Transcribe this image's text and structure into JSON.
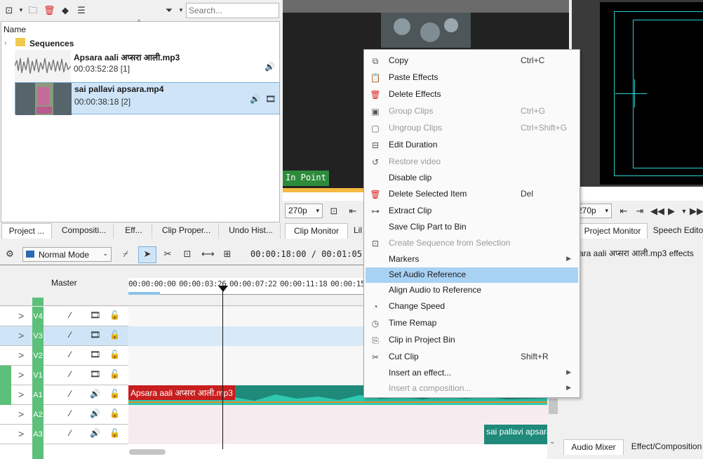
{
  "bin": {
    "search_placeholder": "Search...",
    "header_name": "Name",
    "folder": "Sequences",
    "clips": [
      {
        "name": "Apsara aali अप्सरा आली.mp3",
        "duration": "00:03:52:28 [1]"
      },
      {
        "name": "sai pallavi apsara.mp4",
        "duration": "00:00:38:18 [2]"
      }
    ]
  },
  "bottom_left_tabs": [
    "Project ...",
    "Compositi...",
    "Eff...",
    "Clip Proper...",
    "Undo Hist..."
  ],
  "clip_monitor": {
    "in_point_label": "In Point",
    "resolution": "270p",
    "tab_active": "Clip Monitor",
    "tab_next": "Lil"
  },
  "project_monitor": {
    "resolution": "270p",
    "tab_active": "Project Monitor",
    "tab_next": "Speech Edito",
    "effects_label": "sara aali अप्सरा आली.mp3 effects",
    "bottom_tabs": [
      "Audio Mixer",
      "Effect/Composition"
    ]
  },
  "timeline": {
    "mode": "Normal Mode",
    "timecode": "00:00:18:00 / 00:01:05:",
    "master_label": "Master",
    "ruler_ticks": [
      "00:00:00:00",
      "00:00:03:26",
      "00:00:07:22",
      "00:00:11:18",
      "00:00:15:"
    ],
    "tracks": [
      "V4",
      "V3",
      "V2",
      "V1",
      "A1",
      "A2",
      "A3"
    ],
    "clip_a1": "Apsara aali अप्सरा आली.mp3",
    "clip_a3": "sai pallavi apsara"
  },
  "context_menu": {
    "items": [
      {
        "label": "Copy",
        "shortcut": "Ctrl+C",
        "icon": "copy-icon",
        "disabled": false
      },
      {
        "label": "Paste Effects",
        "shortcut": "",
        "icon": "paste-icon",
        "disabled": false
      },
      {
        "label": "Delete Effects",
        "shortcut": "",
        "icon": "trash-icon",
        "disabled": false
      },
      {
        "label": "Group Clips",
        "shortcut": "Ctrl+G",
        "icon": "group-icon",
        "disabled": true
      },
      {
        "label": "Ungroup Clips",
        "shortcut": "Ctrl+Shift+G",
        "icon": "ungroup-icon",
        "disabled": true
      },
      {
        "label": "Edit Duration",
        "shortcut": "",
        "icon": "duration-icon",
        "disabled": false
      },
      {
        "label": "Restore video",
        "shortcut": "",
        "icon": "restore-icon",
        "disabled": true
      },
      {
        "label": "Disable clip",
        "shortcut": "",
        "icon": "",
        "disabled": false
      },
      {
        "label": "Delete Selected Item",
        "shortcut": "Del",
        "icon": "trash-icon",
        "disabled": false
      },
      {
        "label": "Extract Clip",
        "shortcut": "",
        "icon": "extract-icon",
        "disabled": false
      },
      {
        "label": "Save Clip Part to Bin",
        "shortcut": "",
        "icon": "",
        "disabled": false
      },
      {
        "label": "Create Sequence from Selection",
        "shortcut": "",
        "icon": "sequence-icon",
        "disabled": true
      },
      {
        "label": "Markers",
        "shortcut": "",
        "icon": "",
        "disabled": false,
        "submenu": true
      },
      {
        "label": "Set Audio Reference",
        "shortcut": "",
        "icon": "",
        "disabled": false,
        "highlighted": true
      },
      {
        "label": "Align Audio to Reference",
        "shortcut": "",
        "icon": "",
        "disabled": false
      },
      {
        "label": "Change Speed",
        "shortcut": "",
        "icon": "speed-icon",
        "disabled": false
      },
      {
        "label": "Time Remap",
        "shortcut": "",
        "icon": "remap-icon",
        "disabled": false
      },
      {
        "label": "Clip in Project Bin",
        "shortcut": "",
        "icon": "bin-icon",
        "disabled": false
      },
      {
        "label": "Cut Clip",
        "shortcut": "Shift+R",
        "icon": "scissors-icon",
        "disabled": false
      },
      {
        "label": "Insert an effect...",
        "shortcut": "",
        "icon": "",
        "disabled": false,
        "submenu": true
      },
      {
        "label": "Insert a composition...",
        "shortcut": "",
        "icon": "",
        "disabled": true,
        "submenu": true
      }
    ]
  }
}
